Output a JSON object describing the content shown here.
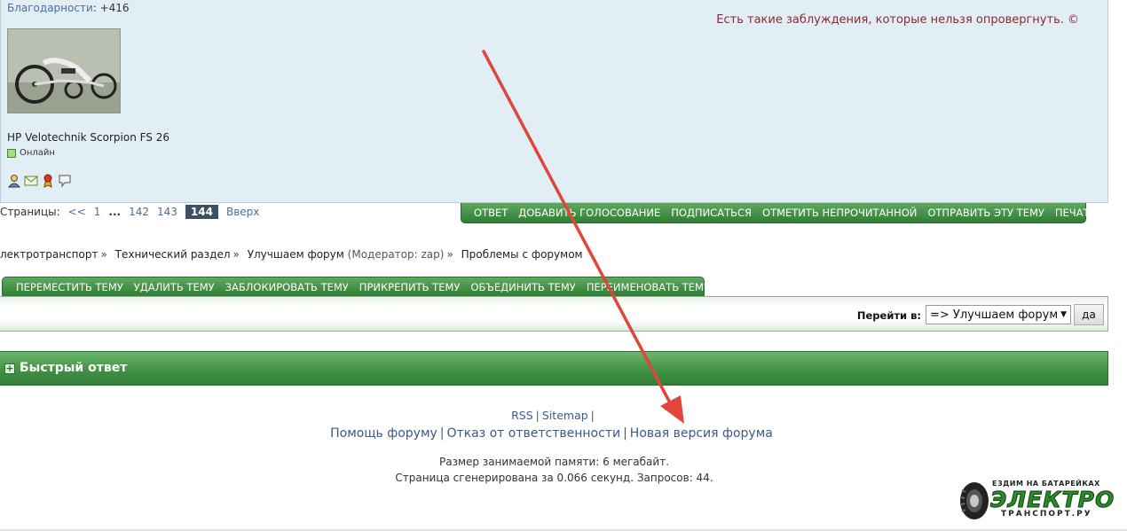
{
  "post": {
    "thanks_label": "Благодарности",
    "thanks_value": ": +416",
    "username": "HP Velotechnik Scorpion FS 26",
    "status": "Онлайн",
    "signature": "Есть такие заблуждения, которые нельзя опровергнуть. ©"
  },
  "pager": {
    "label": "Страницы:",
    "prev": "<<",
    "first": "1",
    "ellipsis": "...",
    "p142": "142",
    "p143": "143",
    "current": "144",
    "top": "Вверх"
  },
  "actions": [
    "ОТВЕТ",
    "ДОБАВИТЬ ГОЛОСОВАНИЕ",
    "ПОДПИСАТЬСЯ",
    "ОТМЕТИТЬ НЕПРОЧИТАННОЙ",
    "ОТПРАВИТЬ ЭТУ ТЕМУ",
    "ПЕЧАТЬ"
  ],
  "breadcrumb": {
    "c1": "лектротранспорт",
    "c2": "Технический раздел",
    "c3": "Улучшаем форум",
    "moderator": "(Модератор: zap)",
    "c4": "Проблемы с форумом",
    "sep": "»"
  },
  "moderation": [
    "ПЕРЕМЕСТИТЬ ТЕМУ",
    "УДАЛИТЬ ТЕМУ",
    "ЗАБЛОКИРОВАТЬ ТЕМУ",
    "ПРИКРЕПИТЬ ТЕМУ",
    "ОБЪЕДИНИТЬ ТЕМУ",
    "ПЕРЕИМЕНОВАТЬ ТЕМУ"
  ],
  "jump": {
    "label": "Перейти в:",
    "selected": "=> Улучшаем форум",
    "go": "да"
  },
  "quickreply": {
    "plus": "+",
    "title": "Быстрый ответ"
  },
  "footer": {
    "rss": "RSS",
    "sitemap": "Sitemap",
    "help": "Помощь форуму",
    "disclaimer": "Отказ от ответственности",
    "new_version": "Новая версия форума",
    "memory": "Размер занимаемой памяти: 6 мегабайт.",
    "generated": "Страница сгенерирована за 0.066 секунд. Запросов: 44."
  },
  "logo": {
    "tag": "ЕЗДИМ НА БАТАРЕЙКАХ",
    "big": "ЭЛЕКТРО",
    "small": "ТРАНСПОРТ.РУ"
  },
  "colors": {
    "accent_green": "#3f8f43",
    "post_bg": "#e1eef6",
    "arrow": "#e0463a",
    "link": "#3a5a8a"
  }
}
